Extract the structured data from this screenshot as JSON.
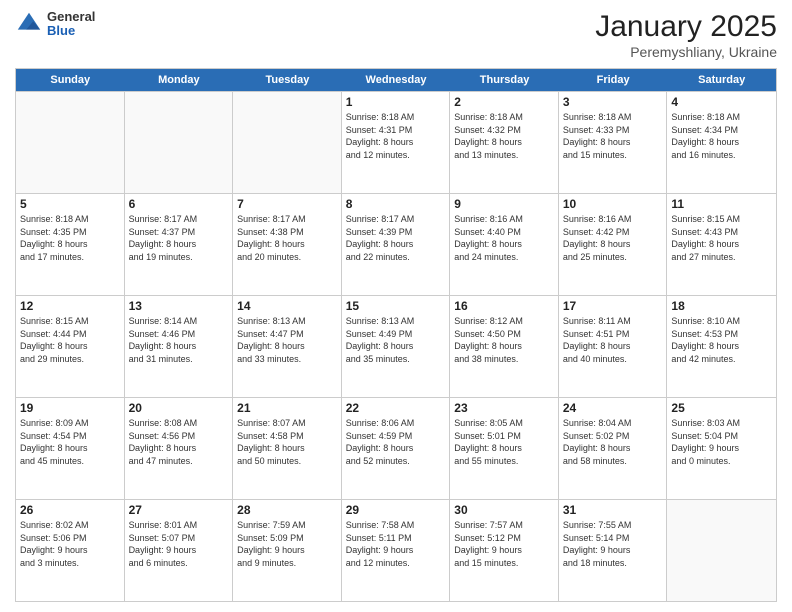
{
  "header": {
    "logo_general": "General",
    "logo_blue": "Blue",
    "month": "January 2025",
    "location": "Peremyshliany, Ukraine"
  },
  "weekdays": [
    "Sunday",
    "Monday",
    "Tuesday",
    "Wednesday",
    "Thursday",
    "Friday",
    "Saturday"
  ],
  "rows": [
    [
      {
        "day": "",
        "detail": ""
      },
      {
        "day": "",
        "detail": ""
      },
      {
        "day": "",
        "detail": ""
      },
      {
        "day": "1",
        "detail": "Sunrise: 8:18 AM\nSunset: 4:31 PM\nDaylight: 8 hours\nand 12 minutes."
      },
      {
        "day": "2",
        "detail": "Sunrise: 8:18 AM\nSunset: 4:32 PM\nDaylight: 8 hours\nand 13 minutes."
      },
      {
        "day": "3",
        "detail": "Sunrise: 8:18 AM\nSunset: 4:33 PM\nDaylight: 8 hours\nand 15 minutes."
      },
      {
        "day": "4",
        "detail": "Sunrise: 8:18 AM\nSunset: 4:34 PM\nDaylight: 8 hours\nand 16 minutes."
      }
    ],
    [
      {
        "day": "5",
        "detail": "Sunrise: 8:18 AM\nSunset: 4:35 PM\nDaylight: 8 hours\nand 17 minutes."
      },
      {
        "day": "6",
        "detail": "Sunrise: 8:17 AM\nSunset: 4:37 PM\nDaylight: 8 hours\nand 19 minutes."
      },
      {
        "day": "7",
        "detail": "Sunrise: 8:17 AM\nSunset: 4:38 PM\nDaylight: 8 hours\nand 20 minutes."
      },
      {
        "day": "8",
        "detail": "Sunrise: 8:17 AM\nSunset: 4:39 PM\nDaylight: 8 hours\nand 22 minutes."
      },
      {
        "day": "9",
        "detail": "Sunrise: 8:16 AM\nSunset: 4:40 PM\nDaylight: 8 hours\nand 24 minutes."
      },
      {
        "day": "10",
        "detail": "Sunrise: 8:16 AM\nSunset: 4:42 PM\nDaylight: 8 hours\nand 25 minutes."
      },
      {
        "day": "11",
        "detail": "Sunrise: 8:15 AM\nSunset: 4:43 PM\nDaylight: 8 hours\nand 27 minutes."
      }
    ],
    [
      {
        "day": "12",
        "detail": "Sunrise: 8:15 AM\nSunset: 4:44 PM\nDaylight: 8 hours\nand 29 minutes."
      },
      {
        "day": "13",
        "detail": "Sunrise: 8:14 AM\nSunset: 4:46 PM\nDaylight: 8 hours\nand 31 minutes."
      },
      {
        "day": "14",
        "detail": "Sunrise: 8:13 AM\nSunset: 4:47 PM\nDaylight: 8 hours\nand 33 minutes."
      },
      {
        "day": "15",
        "detail": "Sunrise: 8:13 AM\nSunset: 4:49 PM\nDaylight: 8 hours\nand 35 minutes."
      },
      {
        "day": "16",
        "detail": "Sunrise: 8:12 AM\nSunset: 4:50 PM\nDaylight: 8 hours\nand 38 minutes."
      },
      {
        "day": "17",
        "detail": "Sunrise: 8:11 AM\nSunset: 4:51 PM\nDaylight: 8 hours\nand 40 minutes."
      },
      {
        "day": "18",
        "detail": "Sunrise: 8:10 AM\nSunset: 4:53 PM\nDaylight: 8 hours\nand 42 minutes."
      }
    ],
    [
      {
        "day": "19",
        "detail": "Sunrise: 8:09 AM\nSunset: 4:54 PM\nDaylight: 8 hours\nand 45 minutes."
      },
      {
        "day": "20",
        "detail": "Sunrise: 8:08 AM\nSunset: 4:56 PM\nDaylight: 8 hours\nand 47 minutes."
      },
      {
        "day": "21",
        "detail": "Sunrise: 8:07 AM\nSunset: 4:58 PM\nDaylight: 8 hours\nand 50 minutes."
      },
      {
        "day": "22",
        "detail": "Sunrise: 8:06 AM\nSunset: 4:59 PM\nDaylight: 8 hours\nand 52 minutes."
      },
      {
        "day": "23",
        "detail": "Sunrise: 8:05 AM\nSunset: 5:01 PM\nDaylight: 8 hours\nand 55 minutes."
      },
      {
        "day": "24",
        "detail": "Sunrise: 8:04 AM\nSunset: 5:02 PM\nDaylight: 8 hours\nand 58 minutes."
      },
      {
        "day": "25",
        "detail": "Sunrise: 8:03 AM\nSunset: 5:04 PM\nDaylight: 9 hours\nand 0 minutes."
      }
    ],
    [
      {
        "day": "26",
        "detail": "Sunrise: 8:02 AM\nSunset: 5:06 PM\nDaylight: 9 hours\nand 3 minutes."
      },
      {
        "day": "27",
        "detail": "Sunrise: 8:01 AM\nSunset: 5:07 PM\nDaylight: 9 hours\nand 6 minutes."
      },
      {
        "day": "28",
        "detail": "Sunrise: 7:59 AM\nSunset: 5:09 PM\nDaylight: 9 hours\nand 9 minutes."
      },
      {
        "day": "29",
        "detail": "Sunrise: 7:58 AM\nSunset: 5:11 PM\nDaylight: 9 hours\nand 12 minutes."
      },
      {
        "day": "30",
        "detail": "Sunrise: 7:57 AM\nSunset: 5:12 PM\nDaylight: 9 hours\nand 15 minutes."
      },
      {
        "day": "31",
        "detail": "Sunrise: 7:55 AM\nSunset: 5:14 PM\nDaylight: 9 hours\nand 18 minutes."
      },
      {
        "day": "",
        "detail": ""
      }
    ]
  ]
}
